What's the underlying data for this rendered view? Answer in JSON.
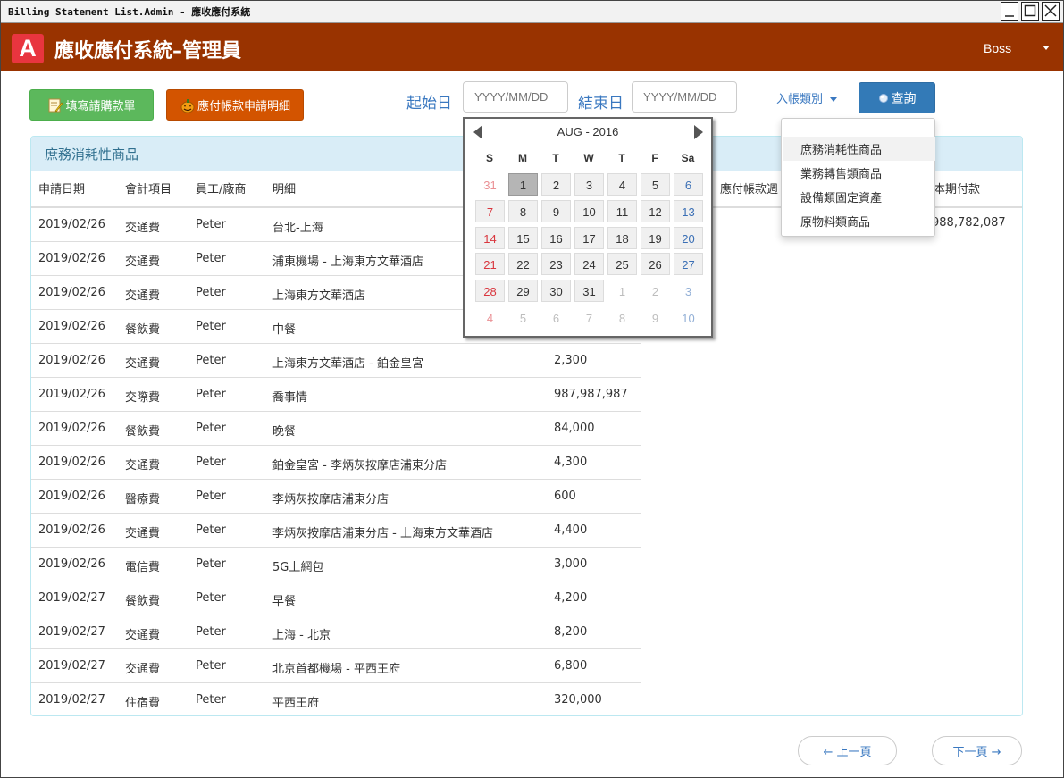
{
  "window": {
    "title": "Billing Statement List.Admin - 應收應付系統"
  },
  "app": {
    "logo_letter": "A",
    "title": "應收應付系統–管理員",
    "user": "Boss"
  },
  "toolbar": {
    "fill_request_label": "填寫請購款單",
    "payable_detail_label": "應付帳款申請明細",
    "start_label": "起始日",
    "start_placeholder": "YYYY/MM/DD",
    "end_label": "結束日",
    "end_placeholder": "YYYY/MM/DD",
    "category_label": "入帳類別",
    "query_label": "查詢"
  },
  "panel": {
    "heading": "庶務消耗性商品",
    "columns": [
      "申請日期",
      "會計項目",
      "員工/廠商",
      "明細",
      "應付帳款週",
      "本期付款"
    ],
    "first_row_extra": "988,782,087",
    "rows": [
      {
        "date": "2019/02/26",
        "item": "交通費",
        "employee": "Peter",
        "detail": "台北-上海",
        "amount": ""
      },
      {
        "date": "2019/02/26",
        "item": "交通費",
        "employee": "Peter",
        "detail": "浦東機場 - 上海東方文華酒店",
        "amount": ""
      },
      {
        "date": "2019/02/26",
        "item": "交通費",
        "employee": "Peter",
        "detail": "上海東方文華酒店",
        "amount": ""
      },
      {
        "date": "2019/02/26",
        "item": "餐飲費",
        "employee": "Peter",
        "detail": "中餐",
        "amount": ""
      },
      {
        "date": "2019/02/26",
        "item": "交通費",
        "employee": "Peter",
        "detail": "上海東方文華酒店 - 鉑金皇宮",
        "amount": "2,300"
      },
      {
        "date": "2019/02/26",
        "item": "交際費",
        "employee": "Peter",
        "detail": "喬事情",
        "amount": "987,987,987"
      },
      {
        "date": "2019/02/26",
        "item": "餐飲費",
        "employee": "Peter",
        "detail": "晚餐",
        "amount": "84,000"
      },
      {
        "date": "2019/02/26",
        "item": "交通費",
        "employee": "Peter",
        "detail": "鉑金皇宮 - 李炳灰按摩店浦東分店",
        "amount": "4,300"
      },
      {
        "date": "2019/02/26",
        "item": "醫療費",
        "employee": "Peter",
        "detail": "李炳灰按摩店浦東分店",
        "amount": "600"
      },
      {
        "date": "2019/02/26",
        "item": "交通費",
        "employee": "Peter",
        "detail": "李炳灰按摩店浦東分店 - 上海東方文華酒店",
        "amount": "4,400"
      },
      {
        "date": "2019/02/26",
        "item": "電信費",
        "employee": "Peter",
        "detail": "5G上網包",
        "amount": "3,000"
      },
      {
        "date": "2019/02/27",
        "item": "餐飲費",
        "employee": "Peter",
        "detail": "早餐",
        "amount": "4,200"
      },
      {
        "date": "2019/02/27",
        "item": "交通費",
        "employee": "Peter",
        "detail": "上海 - 北京",
        "amount": "8,200"
      },
      {
        "date": "2019/02/27",
        "item": "交通費",
        "employee": "Peter",
        "detail": "北京首都機場 - 平西王府",
        "amount": "6,800"
      },
      {
        "date": "2019/02/27",
        "item": "住宿費",
        "employee": "Peter",
        "detail": "平西王府",
        "amount": "320,000"
      }
    ]
  },
  "calendar": {
    "month_label": "AUG - 2016",
    "weekdays": [
      "S",
      "M",
      "T",
      "W",
      "T",
      "F",
      "Sa"
    ],
    "selected_day": "1",
    "weeks": [
      [
        "31",
        "1",
        "2",
        "3",
        "4",
        "5",
        "6"
      ],
      [
        "7",
        "8",
        "9",
        "10",
        "11",
        "12",
        "13"
      ],
      [
        "14",
        "15",
        "16",
        "17",
        "18",
        "19",
        "20"
      ],
      [
        "21",
        "22",
        "23",
        "24",
        "25",
        "26",
        "27"
      ],
      [
        "28",
        "29",
        "30",
        "31",
        "1",
        "2",
        "3"
      ],
      [
        "4",
        "5",
        "6",
        "7",
        "8",
        "9",
        "10"
      ]
    ],
    "other_month": [
      [
        true,
        false,
        false,
        false,
        false,
        false,
        false
      ],
      [
        false,
        false,
        false,
        false,
        false,
        false,
        false
      ],
      [
        false,
        false,
        false,
        false,
        false,
        false,
        false
      ],
      [
        false,
        false,
        false,
        false,
        false,
        false,
        false
      ],
      [
        false,
        false,
        false,
        false,
        true,
        true,
        true
      ],
      [
        true,
        true,
        true,
        true,
        true,
        true,
        true
      ]
    ]
  },
  "category_menu": {
    "items": [
      "庶務消耗性商品",
      "業務轉售類商品",
      "設備類固定資產",
      "原物料類商品"
    ],
    "active_index": 0
  },
  "pagination": {
    "prev_label": "← 上一頁",
    "next_label": "下一頁 →"
  },
  "colors": {
    "appbar": "#993300",
    "logo": "#e8353f",
    "green_button": "#5cb85c",
    "orange_button": "#d35400",
    "blue_button": "#337ab7",
    "sunday_red": "#d9363e",
    "saturday_blue": "#3a6fb5",
    "panel_heading_bg": "#d9edf7",
    "panel_heading_text": "#31708f"
  }
}
